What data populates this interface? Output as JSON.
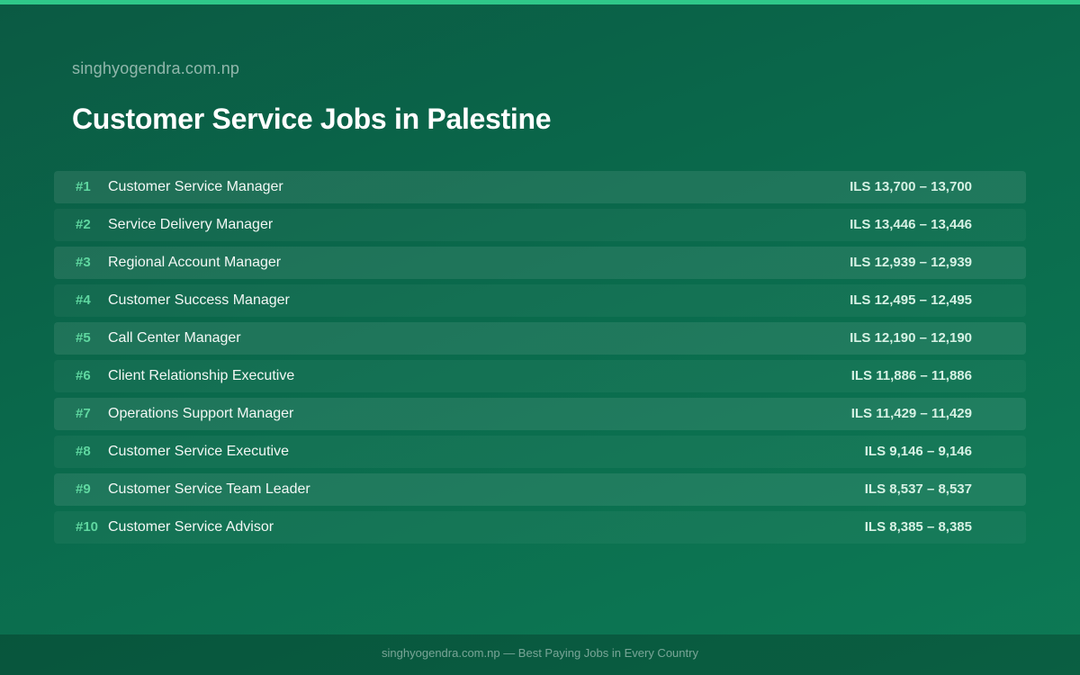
{
  "header": {
    "site": "singhyogendra.com.np",
    "title": "Customer Service Jobs in Palestine"
  },
  "jobs": [
    {
      "rank": "#1",
      "title": "Customer Service Manager",
      "salary": "ILS 13,700 – 13,700"
    },
    {
      "rank": "#2",
      "title": "Service Delivery Manager",
      "salary": "ILS 13,446 – 13,446"
    },
    {
      "rank": "#3",
      "title": "Regional Account Manager",
      "salary": "ILS 12,939 – 12,939"
    },
    {
      "rank": "#4",
      "title": "Customer Success Manager",
      "salary": "ILS 12,495 – 12,495"
    },
    {
      "rank": "#5",
      "title": "Call Center Manager",
      "salary": "ILS 12,190 – 12,190"
    },
    {
      "rank": "#6",
      "title": "Client Relationship Executive",
      "salary": "ILS 11,886 – 11,886"
    },
    {
      "rank": "#7",
      "title": "Operations Support Manager",
      "salary": "ILS 11,429 – 11,429"
    },
    {
      "rank": "#8",
      "title": "Customer Service Executive",
      "salary": "ILS 9,146 – 9,146"
    },
    {
      "rank": "#9",
      "title": "Customer Service Team Leader",
      "salary": "ILS 8,537 – 8,537"
    },
    {
      "rank": "#10",
      "title": "Customer Service Advisor",
      "salary": "ILS 8,385 – 8,385"
    }
  ],
  "footer": {
    "text": "singhyogendra.com.np — Best Paying Jobs in Every Country"
  },
  "colors": {
    "accent": "#2fc889",
    "rank": "#5fd7a0",
    "background": "#0a6a4c"
  }
}
